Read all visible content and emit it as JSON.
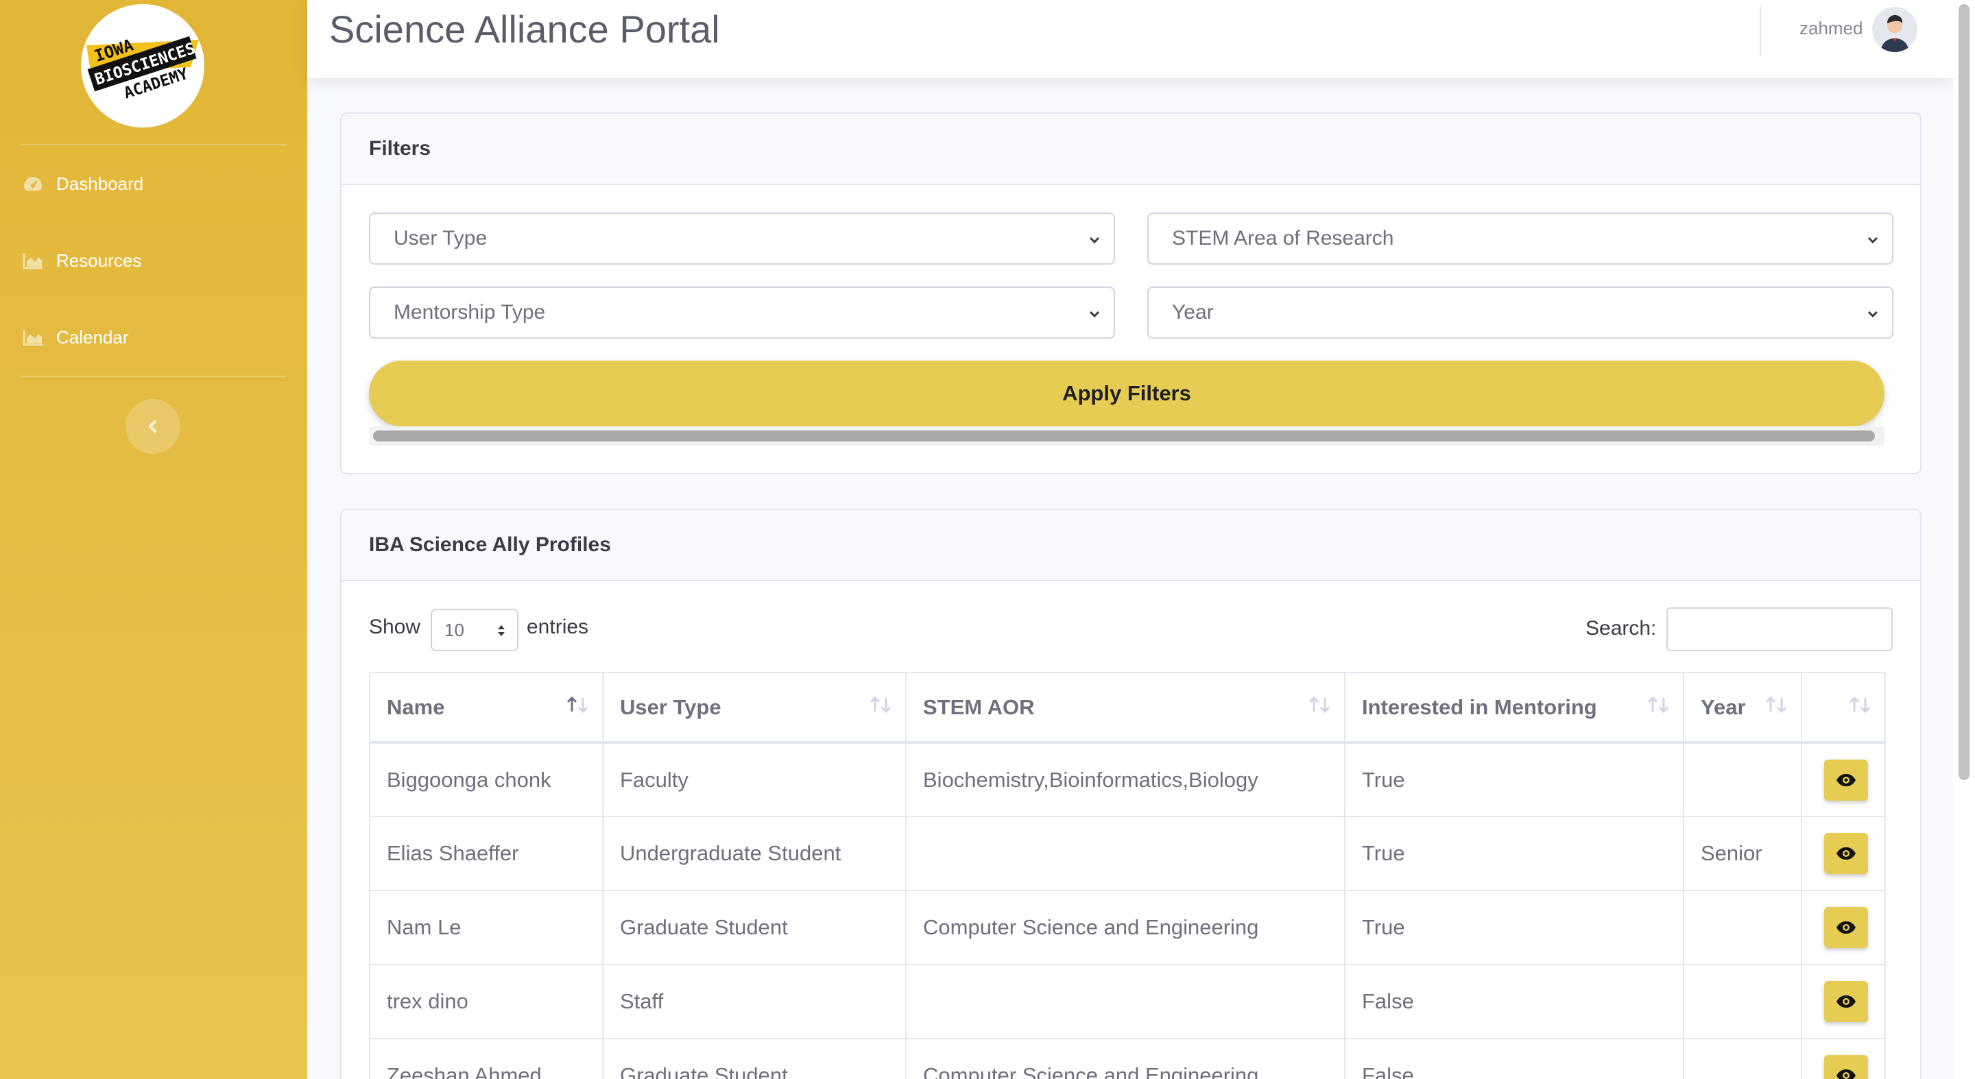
{
  "app": {
    "title": "Science Alliance Portal",
    "logo_text": [
      "IOWA",
      "BIOSCIENCES",
      "ACADEMY"
    ],
    "accent_color": "#e2b637"
  },
  "sidebar": {
    "items": [
      {
        "label": "Dashboard",
        "icon": "gauge-icon"
      },
      {
        "label": "Resources",
        "icon": "chart-area-icon"
      },
      {
        "label": "Calendar",
        "icon": "chart-area-icon"
      }
    ],
    "toggle_icon": "chevron-left-icon"
  },
  "topbar": {
    "username": "zahmed",
    "avatar_icon": "user-avatar"
  },
  "filters": {
    "header": "Filters",
    "user_type": "User Type",
    "stem_area": "STEM Area of Research",
    "mentorship_type": "Mentorship Type",
    "year": "Year",
    "apply_label": "Apply Filters"
  },
  "profiles": {
    "header": "IBA Science Ally Profiles",
    "show_label": "Show",
    "entries_label": "entries",
    "page_length": "10",
    "search_label": "Search:",
    "search_value": "",
    "columns": [
      "Name",
      "User Type",
      "STEM AOR",
      "Interested in Mentoring",
      "Year",
      ""
    ],
    "sorted_column": "Name",
    "rows": [
      {
        "name": "Biggoonga chonk",
        "user_type": "Faculty",
        "stem_aor": "Biochemistry,Bioinformatics,Biology",
        "mentoring": "True",
        "year": ""
      },
      {
        "name": "Elias Shaeffer",
        "user_type": "Undergraduate Student",
        "stem_aor": "",
        "mentoring": "True",
        "year": "Senior"
      },
      {
        "name": "Nam Le",
        "user_type": "Graduate Student",
        "stem_aor": "Computer Science and Engineering",
        "mentoring": "True",
        "year": ""
      },
      {
        "name": "trex dino",
        "user_type": "Staff",
        "stem_aor": "",
        "mentoring": "False",
        "year": ""
      },
      {
        "name": "Zeeshan Ahmed",
        "user_type": "Graduate Student",
        "stem_aor": "Computer Science and Engineering",
        "mentoring": "False",
        "year": ""
      }
    ],
    "row_action_icon": "eye-icon"
  }
}
